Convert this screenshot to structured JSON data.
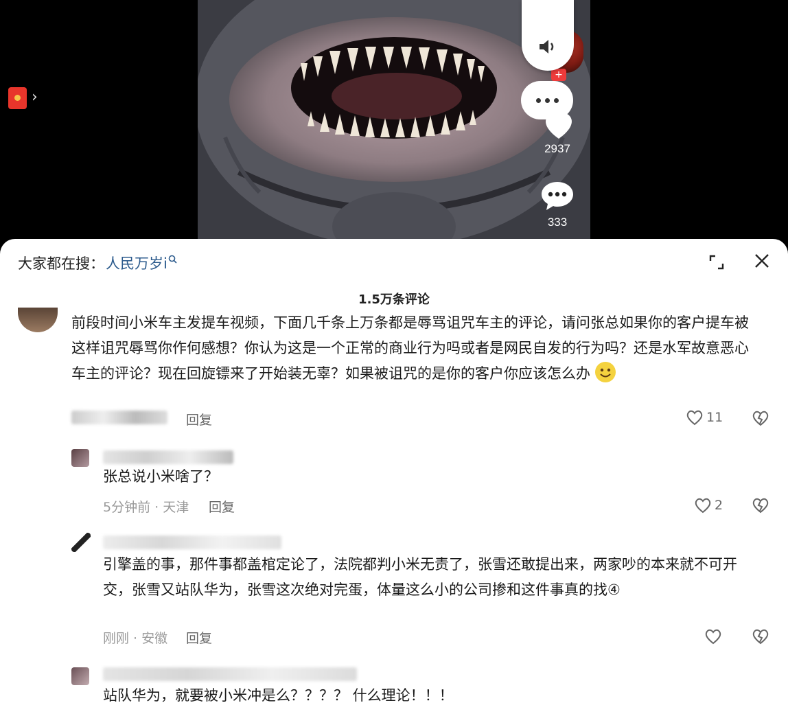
{
  "video": {
    "like_count": "2937",
    "comment_count": "333",
    "icons": [
      "red-packet-icon",
      "volume-icon",
      "more-icon",
      "heart-icon",
      "comment-icon"
    ]
  },
  "search": {
    "prefix": "大家都在搜：",
    "query": "人民万岁i"
  },
  "panel": {
    "comment_count": "1.5万条评论"
  },
  "comments": [
    {
      "text": "前段时间小米车主发提车视频，下面几千条上万条都是辱骂诅咒车主的评论，请问张总如果你的客户提车被这样诅咒辱骂你作何感想？你认为这是一个正常的商业行为吗或者是网民自发的行为吗？还是水军故意恶心车主的评论？现在回旋镖来了开始装无辜？如果被诅咒的是你的客户你应该怎么办",
      "reply_label": "回复",
      "likes": "11"
    },
    {
      "text": "张总说小米啥了？",
      "meta": "5分钟前 · 天津",
      "reply_label": "回复",
      "likes": "2"
    },
    {
      "text": "引擎盖的事，那件事都盖棺定论了，法院都判小米无责了，张雪还敢提出来，两家吵的本来就不可开交，张雪又站队华为，张雪这次绝对完蛋，体量这么小的公司掺和这件事真的找④",
      "meta": "刚刚 · 安徽",
      "reply_label": "回复",
      "likes": ""
    },
    {
      "text": "站队华为，就要被小米冲是么？？？？ 什么理论！！！"
    }
  ]
}
